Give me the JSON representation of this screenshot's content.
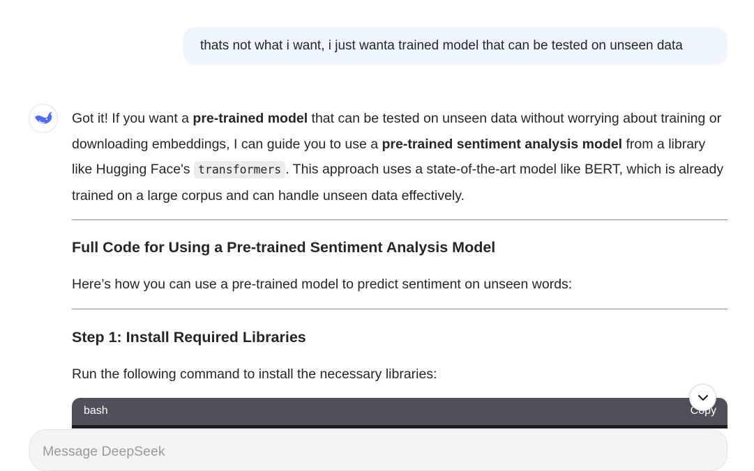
{
  "user_message": "thats not what i want, i just wanta trained model that can be tested on unseen data",
  "assistant": {
    "intro": {
      "t1": "Got it! If you want a ",
      "b1": "pre-trained model",
      "t2": " that can be tested on unseen data without worrying about training or downloading embeddings, I can guide you to use a ",
      "b2": "pre-trained sentiment analysis model",
      "t3": " from a library like Hugging Face's ",
      "code": "transformers",
      "t4": ". This approach uses a state-of-the-art model like BERT, which is already trained on a large corpus and can handle unseen data effectively."
    },
    "section1_heading": "Full Code for Using a Pre-trained Sentiment Analysis Model",
    "section1_text": "Here’s how you can use a pre-trained model to predict sentiment on unseen words:",
    "step1_heading": "Step 1: Install Required Libraries",
    "step1_text": "Run the following command to install the necessary libraries:",
    "code_block": {
      "language": "bash",
      "copy_label": "Copy"
    }
  },
  "composer": {
    "placeholder": "Message DeepSeek",
    "value": ""
  },
  "icons": {
    "avatar": "deepseek-whale-icon",
    "scroll": "chevron-down-icon"
  },
  "colors": {
    "user_bubble": "#eff6ff",
    "code_header": "#50505a",
    "brand": "#4d6bfe"
  }
}
